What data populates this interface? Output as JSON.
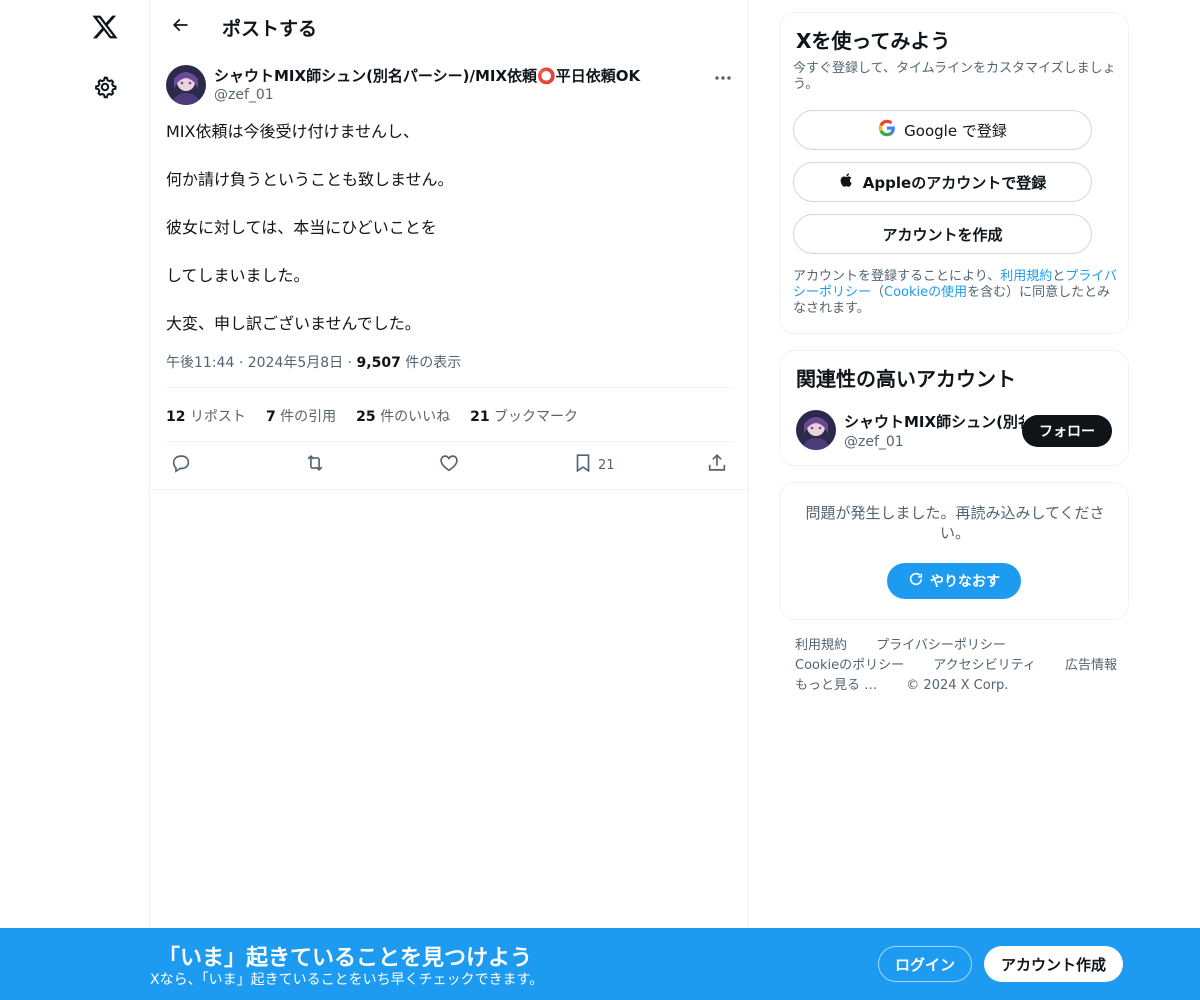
{
  "colors": {
    "accent": "#1d9bf0",
    "text": "#0f1419",
    "muted": "#536471",
    "border": "#eff3f4"
  },
  "nav": {
    "logo_icon": "x-logo-icon",
    "settings_icon": "gear-icon"
  },
  "header": {
    "title": "ポストする",
    "back_icon": "arrow-left-icon"
  },
  "post": {
    "author_name": "シャウトMIX師シュン(別名パーシー)/MIX依頼⭕平日依頼OK",
    "author_handle": "@zef_01",
    "paragraphs": [
      "MIX依頼は今後受け付けませんし、",
      "何か請け負うということも致しません。",
      "彼女に対しては、本当にひどいことを",
      "してしまいました。",
      "大変、申し訳ございませんでした。"
    ],
    "time": "午後11:44",
    "date": "2024年5月8日",
    "views_count": "9,507",
    "views_label": "件の表示",
    "stats": {
      "reposts_count": "12",
      "reposts_label": "リポスト",
      "quotes_count": "7",
      "quotes_label": "件の引用",
      "likes_count": "25",
      "likes_label": "件のいいね",
      "bookmarks_count": "21",
      "bookmarks_label": "ブックマーク"
    },
    "actions": {
      "reply_icon": "reply-icon",
      "repost_icon": "repost-icon",
      "like_icon": "heart-icon",
      "bookmark_icon": "bookmark-icon",
      "bookmark_count": "21",
      "share_icon": "share-icon"
    }
  },
  "signup": {
    "title": "Xを使ってみよう",
    "subtitle": "今すぐ登録して、タイムラインをカスタマイズしましょう。",
    "google_label": "Google で登録",
    "apple_label": "Appleのアカウントで登録",
    "create_label": "アカウントを作成",
    "terms_prefix": "アカウントを登録することにより、",
    "terms_link": "利用規約",
    "terms_and": "と",
    "privacy_link": "プライバシーポリシー",
    "paren_open": "（",
    "cookie_link": "Cookieの使用",
    "terms_suffix": "を含む）に同意したとみなされます。"
  },
  "related": {
    "title": "関連性の高いアカウント",
    "name": "シャウトMIX師シュン(別名パーシー)/MIX依頼⭕平日依頼OK",
    "handle": "@zef_01",
    "follow_label": "フォロー"
  },
  "error": {
    "message": "問題が発生しました。再読み込みしてください。",
    "retry_label": "やりなおす"
  },
  "footer": {
    "links": [
      "利用規約",
      "プライバシーポリシー",
      "Cookieのポリシー",
      "アクセシビリティ",
      "広告情報",
      "もっと見る …",
      "© 2024 X Corp."
    ]
  },
  "banner": {
    "title": "「いま」起きていることを見つけよう",
    "subtitle": "Xなら、「いま」起きていることをいち早くチェックできます。",
    "login_label": "ログイン",
    "create_label": "アカウント作成"
  }
}
